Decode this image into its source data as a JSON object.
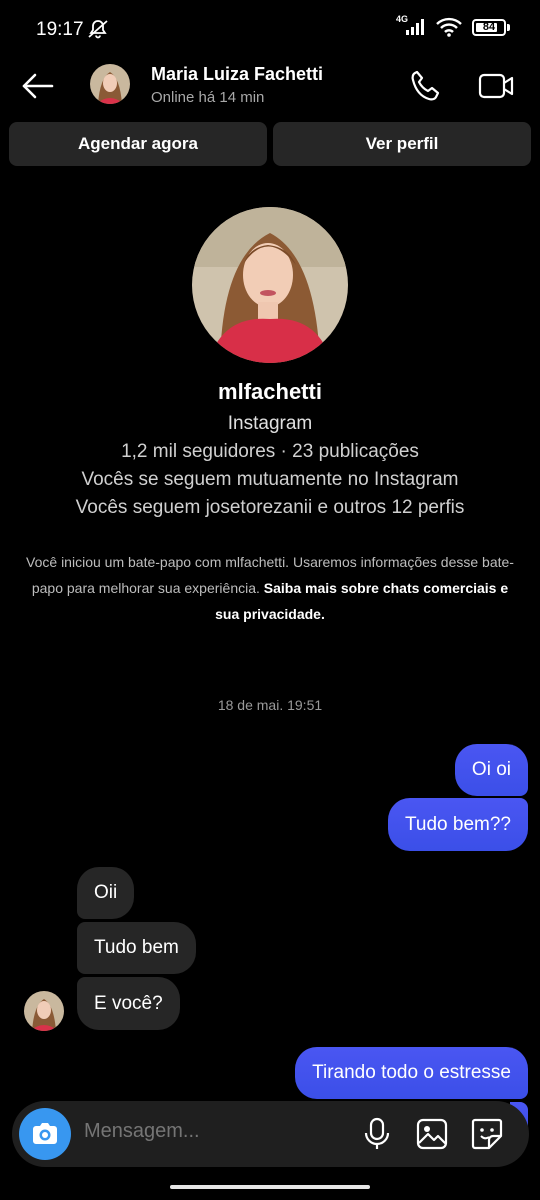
{
  "status_bar": {
    "time": "19:17",
    "network": "4G",
    "battery": "84",
    "battery_level": 0.84
  },
  "header": {
    "name": "Maria Luiza Fachetti",
    "status": "Online há 14 min"
  },
  "actions": {
    "schedule_label": "Agendar agora",
    "profile_label": "Ver perfil"
  },
  "profile": {
    "username": "mlfachetti",
    "source": "Instagram",
    "stats": "1,2 mil seguidores · 23 publicações",
    "mutual": "Vocês se seguem mutuamente no Instagram",
    "following": "Vocês seguem josetorezanii e outros 12 perfis"
  },
  "notice": {
    "text": "Você iniciou um bate-papo com mlfachetti. Usaremos informações desse bate-papo para melhorar sua experiência.",
    "link": "Saiba mais sobre chats comerciais e sua privacidade."
  },
  "timestamp": "18 de mai. 19:51",
  "messages": [
    {
      "from": "me",
      "text": "Oi oi"
    },
    {
      "from": "me",
      "text": "Tudo bem??"
    },
    {
      "from": "them",
      "text": "Oii"
    },
    {
      "from": "them",
      "text": "Tudo bem"
    },
    {
      "from": "them",
      "text": "E você?"
    },
    {
      "from": "me",
      "text": "Tirando todo o estresse"
    }
  ],
  "composer": {
    "placeholder": "Mensagem..."
  },
  "colors": {
    "outgoing_bubble": "#3b4fe8",
    "incoming_bubble": "#262626",
    "camera_button": "#3897f0"
  }
}
